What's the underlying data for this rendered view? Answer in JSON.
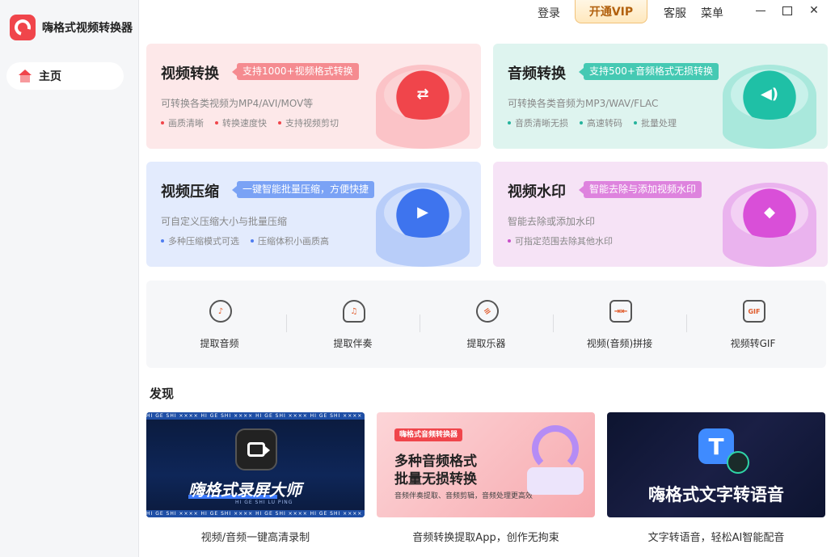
{
  "app": {
    "title": "嗨格式视频转换器",
    "brand_color": "#f0454b"
  },
  "sidebar": {
    "items": [
      {
        "label": "主页",
        "icon": "home-icon"
      }
    ]
  },
  "titlebar": {
    "login": "登录",
    "vip": "开通VIP",
    "service": "客服",
    "menu": "菜单"
  },
  "cards": [
    {
      "title": "视频转换",
      "tag": "支持1000+视频格式转换",
      "desc": "可转换各类视频为MP4/AVI/MOV等",
      "bullets": [
        "画质清晰",
        "转换速度快",
        "支持视频剪切"
      ],
      "icon": "video-convert-icon"
    },
    {
      "title": "音频转换",
      "tag": "支持500+音频格式无损转换",
      "desc": "可转换各类音频为MP3/WAV/FLAC",
      "bullets": [
        "音质清晰无损",
        "高速转码",
        "批量处理"
      ],
      "icon": "audio-convert-icon"
    },
    {
      "title": "视频压缩",
      "tag": "一键智能批量压缩，方便快捷",
      "desc": "可自定义压缩大小与批量压缩",
      "bullets": [
        "多种压缩模式可选",
        "压缩体积小画质高"
      ],
      "icon": "video-compress-icon"
    },
    {
      "title": "视频水印",
      "tag": "智能去除与添加视频水印",
      "desc": "智能去除或添加水印",
      "bullets": [
        "可指定范围去除其他水印"
      ],
      "icon": "watermark-icon"
    }
  ],
  "tools": [
    {
      "label": "提取音频",
      "icon": "microphone-icon"
    },
    {
      "label": "提取伴奏",
      "icon": "accompaniment-icon"
    },
    {
      "label": "提取乐器",
      "icon": "guitar-icon"
    },
    {
      "label": "视频(音频)拼接",
      "icon": "merge-icon"
    },
    {
      "label": "视频转GIF",
      "icon": "gif-icon"
    }
  ],
  "discover": {
    "title": "发现",
    "promos": [
      {
        "caption": "视频/音频一键高清录制",
        "strip_text": "HI GE SHI ×××× HI GE SHI ×××× HI GE SHI ×××× HI GE SHI ×××× HI GE SHI",
        "headline": "嗨格式录屏大师",
        "sub": "HI GE SHI LU PING"
      },
      {
        "caption": "音频转换提取App，创作无拘束",
        "badge": "嗨格式音频转换器",
        "line1": "多种音频格式",
        "line2": "批量无损转换",
        "small": "音频伴奏提取、音频剪辑，音频处理更高效"
      },
      {
        "caption": "文字转语音，轻松AI智能配音",
        "headline": "嗨格式文字转语音",
        "badge_letter": "T"
      }
    ]
  }
}
